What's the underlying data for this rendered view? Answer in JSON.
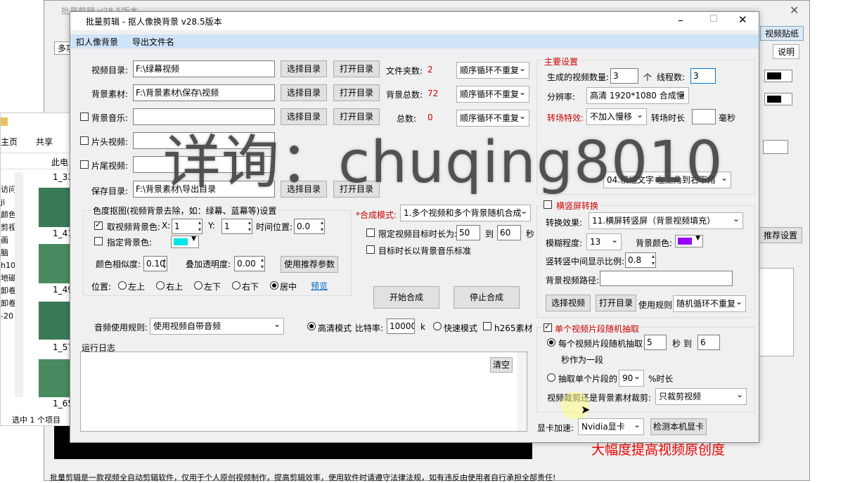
{
  "bg_window": {
    "title": "批量剪辑 v28.5版本",
    "tab_label": "多功",
    "right_tab": "视频贴纸",
    "help": "说明",
    "recommend": "推荐设置",
    "slogan": "大幅度提高视频原创度",
    "footer": "批量剪辑是一款视频全自动剪辑软件，仅用于个人原创视频制作，提高剪辑效率，使用软件时请遵守法律法规，如有违反由使用者自行承担全部责任!"
  },
  "explorer": {
    "home": "主页",
    "share": "共享",
    "pc": "此电",
    "files": [
      "1_33",
      "1_41",
      "1_49",
      "1_57",
      "1_65"
    ],
    "side": [
      "访问",
      "ji",
      "颜色",
      "剪视",
      "画",
      "脑",
      "h10",
      "地磁",
      "卸卷",
      "卸卷",
      "-20"
    ],
    "status": "选中 1 个项目"
  },
  "window": {
    "title": "批量剪辑 - 抠人像换背景  v28.5版本",
    "menu": [
      "扣人像背景",
      "导出文件名"
    ]
  },
  "rows": {
    "video_dir_label": "视频目录:",
    "video_dir": "F:\\绿幕视频",
    "bg_label": "背景素材:",
    "bg_dir": "F:\\背景素材\\保存\\视频",
    "music_label": "背景音乐:",
    "head_label": "片头视频:",
    "tail_label": "片尾视频:",
    "save_label": "保存目录:",
    "save_dir": "F:\\背景素材\\导出目录",
    "choose": "选择目录",
    "open": "打开目录",
    "folder_count_label": "文件夹数:",
    "folder_count": "2",
    "bg_count_label": "背景总数:",
    "bg_count": "72",
    "music_count_label": "总数:",
    "music_count": "0",
    "loop": "顺序循环不重复"
  },
  "chroma": {
    "title": "色度抠图(视频背景去除，如：绿幕、蓝幕等)设置",
    "take_bg": "取视频背景色:",
    "x_label": "X:",
    "x": "1",
    "y_label": "Y:",
    "y": "1",
    "time_label": "时间位置:",
    "time": "0.0",
    "specify": "指定背景色:",
    "sim_label": "颜色相似度:",
    "sim": "0.10",
    "alpha_label": "叠加透明度:",
    "alpha": "0.00",
    "recommend_btn": "使用推荐参数",
    "pos_label": "位置:",
    "positions": [
      "左上",
      "右上",
      "左下",
      "右下",
      "居中"
    ],
    "preview": "预览"
  },
  "compose": {
    "mode_label": "*合成模式:",
    "mode": "1.多个视频和多个背景随机合成",
    "limit": "限定视频目标时长为:",
    "min": "50",
    "to": "到",
    "max": "60",
    "sec": "秒",
    "target": "目标时长以背景音乐标准",
    "start": "开始合成",
    "stop": "停止合成"
  },
  "audio": {
    "label": "音频使用规则:",
    "value": "使用视频自带音频",
    "hd": "高清模式",
    "bitrate_label": "比特率:",
    "bitrate": "10000",
    "k": "k",
    "fast": "快速模式",
    "h265": "h265素材"
  },
  "log": {
    "label": "运行日志",
    "clear": "清空"
  },
  "main_settings": {
    "title": "主要设置",
    "count_label": "生成的视频数量:",
    "count": "3",
    "unit": "个",
    "threads_label": "线程数:",
    "threads": "3",
    "res_label": "分辨率:",
    "res": "高清 1920*1080 合成慢",
    "trans_label": "转场特效:",
    "trans": "不加入慢移",
    "trans_time": "转场时长",
    "ms": "毫秒",
    "corner": "04.横幅文字 左上角到右下角",
    "watermark": "详询：chuqing8010"
  },
  "hv": {
    "title": "横竖屏转换",
    "effect_label": "转换效果:",
    "effect": "11.横屏转竖屏（背景视频填充）",
    "blur_label": "模糊程度:",
    "blur": "13",
    "bgcolor_label": "背景颜色:",
    "ratio_label": "竖转竖中间显示比例:",
    "ratio": "0.8",
    "bgpath_label": "背景视频路径:",
    "choose_video": "选择视频",
    "open_dir": "打开目录",
    "rule_label": "使用规则",
    "rule": "随机循环不重复"
  },
  "clip": {
    "title": "单个视频片段随机抽取",
    "each": "每个视频片段随机抽取",
    "min": "5",
    "sec_to": "秒 到",
    "max": "6",
    "as_one": "秒作为一段",
    "single": "抽取单个片段的",
    "pct": "90",
    "pct_label": "%时长",
    "crop_label": "视频裁剪还是背景素材裁剪:",
    "crop": "只裁剪视频"
  },
  "gpu": {
    "label": "显卡加速:",
    "value": "Nvidia显卡",
    "detect": "检测本机显卡"
  },
  "colors": {
    "cyan": "#00e5e5",
    "purple": "#9900ff",
    "black": "#000000",
    "accent": "#c00000"
  }
}
